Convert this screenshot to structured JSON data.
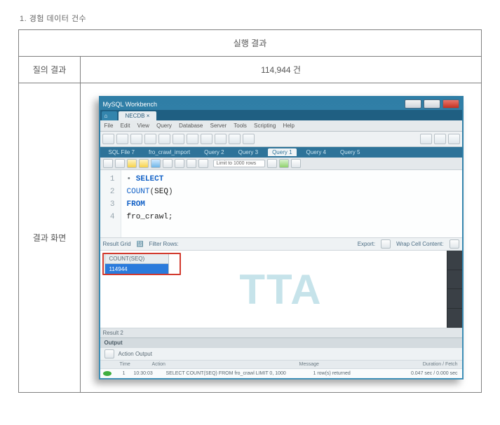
{
  "heading": "1. 경험 데이터 건수",
  "table": {
    "title": "실행 결과",
    "row1_label": "질의 결과",
    "row1_value": "114,944 건",
    "row2_label": "결과 화면"
  },
  "app": {
    "title": "MySQL Workbench",
    "db_tab": "NECDB  ×",
    "menu": [
      "File",
      "Edit",
      "View",
      "Query",
      "Database",
      "Server",
      "Tools",
      "Scripting",
      "Help"
    ],
    "query_tabs": {
      "items": [
        "SQL File 7",
        "fro_crawl_import",
        "Query 2",
        "Query 3",
        "Query 1",
        "Query 4",
        "Query 5"
      ],
      "active_index": 4
    },
    "limit_label": "Limit to 1000 rows",
    "code_lines": [
      {
        "n": "1",
        "html": "<span class='bullet'>•</span> <span class='kw'>SELECT</span>"
      },
      {
        "n": "2",
        "html": "        <span class='fn'>COUNT</span>(<span class='id'>SEQ</span>)"
      },
      {
        "n": "3",
        "html": "  <span class='kw'>FROM</span>"
      },
      {
        "n": "4",
        "html": "        <span class='id'>fro_crawl</span>;"
      }
    ],
    "result_bar": {
      "left": [
        "Result Grid",
        "Filter Rows:"
      ],
      "right": [
        "Export:",
        "Wrap Cell Content:"
      ]
    },
    "grid": {
      "header": "COUNT(SEQ)",
      "value": "114944"
    },
    "tab_strip": "Result 2",
    "output": {
      "title": "Output",
      "mode": "Action Output",
      "headers": {
        "time": "Time",
        "action": "Action",
        "message": "Message",
        "duration": "Duration / Fetch"
      },
      "row": {
        "idx": "1",
        "time": "10:30:03",
        "action": "SELECT   COUNT(SEQ) FROM   fro_crawl LIMIT 0, 1000",
        "message": "1 row(s) returned",
        "duration": "0.047 sec / 0.000 sec"
      }
    },
    "watermark": "TTA"
  }
}
